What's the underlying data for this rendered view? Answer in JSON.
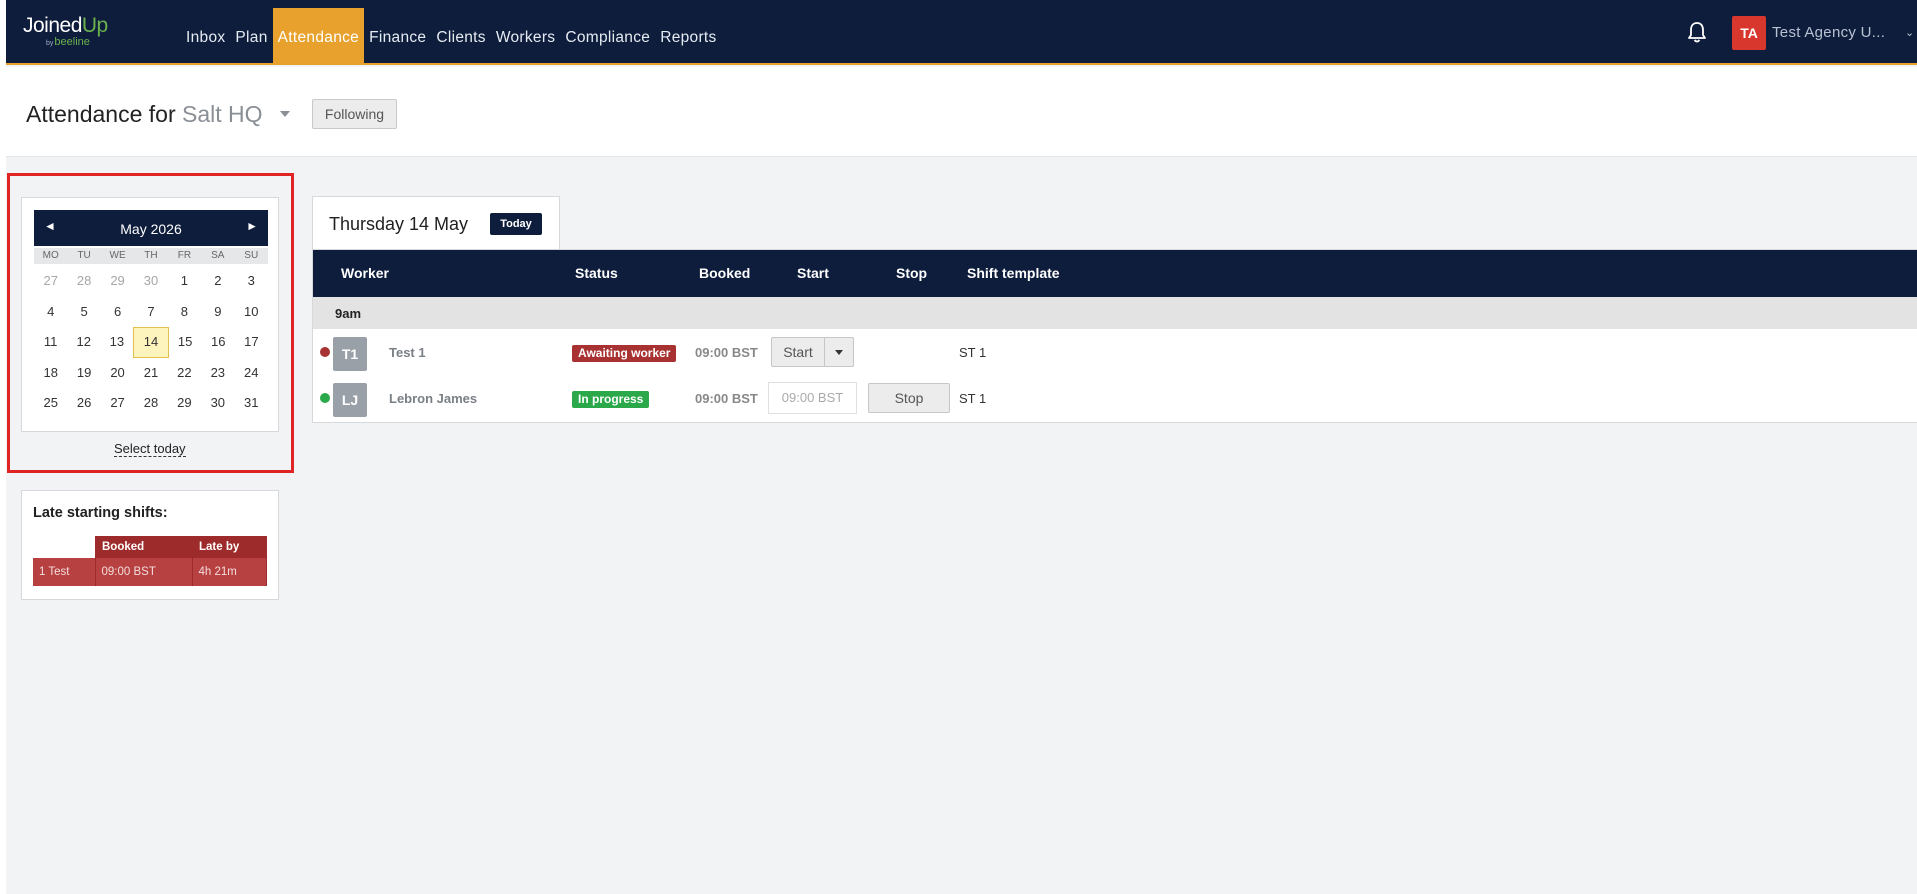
{
  "brand": {
    "name_a": "Joined",
    "name_b": "Up",
    "sub_by": "by",
    "sub_name": "beeline"
  },
  "nav": {
    "items": [
      {
        "label": "Inbox"
      },
      {
        "label": "Plan"
      },
      {
        "label": "Attendance",
        "active": true
      },
      {
        "label": "Finance"
      },
      {
        "label": "Clients"
      },
      {
        "label": "Workers"
      },
      {
        "label": "Compliance"
      },
      {
        "label": "Reports"
      }
    ]
  },
  "user": {
    "initials": "TA",
    "name": "Test Agency U..."
  },
  "header": {
    "title_prefix": "Attendance for",
    "site": "Salt HQ",
    "following_label": "Following"
  },
  "calendar": {
    "prev_icon": "◄",
    "next_icon": "►",
    "month_label": "May 2026",
    "weekdays": [
      "MO",
      "TU",
      "WE",
      "TH",
      "FR",
      "SA",
      "SU"
    ],
    "weeks": [
      [
        "27",
        "28",
        "29",
        "30",
        "1",
        "2",
        "3"
      ],
      [
        "4",
        "5",
        "6",
        "7",
        "8",
        "9",
        "10"
      ],
      [
        "11",
        "12",
        "13",
        "14",
        "15",
        "16",
        "17"
      ],
      [
        "18",
        "19",
        "20",
        "21",
        "22",
        "23",
        "24"
      ],
      [
        "25",
        "26",
        "27",
        "28",
        "29",
        "30",
        "31"
      ]
    ],
    "select_today_label": "Select today"
  },
  "late_shifts": {
    "title": "Late starting shifts:",
    "columns": [
      "",
      "Booked",
      "Late by"
    ],
    "rows": [
      [
        "1 Test",
        "09:00 BST",
        "4h 21m"
      ]
    ]
  },
  "day": {
    "label": "Thursday 14 May",
    "today_label": "Today"
  },
  "shifts_table": {
    "columns": {
      "worker": "Worker",
      "status": "Status",
      "booked": "Booked",
      "start": "Start",
      "stop": "Stop",
      "template": "Shift template"
    },
    "group_label": "9am",
    "rows": [
      {
        "dot_color": "#a83232",
        "initials": "T1",
        "name": "Test 1",
        "status": "Awaiting worker",
        "status_color": "#a83232",
        "booked": "09:00 BST",
        "start_label": "Start",
        "template": "ST 1"
      },
      {
        "dot_color": "#2aa84a",
        "initials": "LJ",
        "name": "Lebron James",
        "status": "In progress",
        "status_color": "#2aa84a",
        "booked": "09:00 BST",
        "start_value": "09:00 BST",
        "stop_label": "Stop",
        "template": "ST 1"
      }
    ]
  }
}
